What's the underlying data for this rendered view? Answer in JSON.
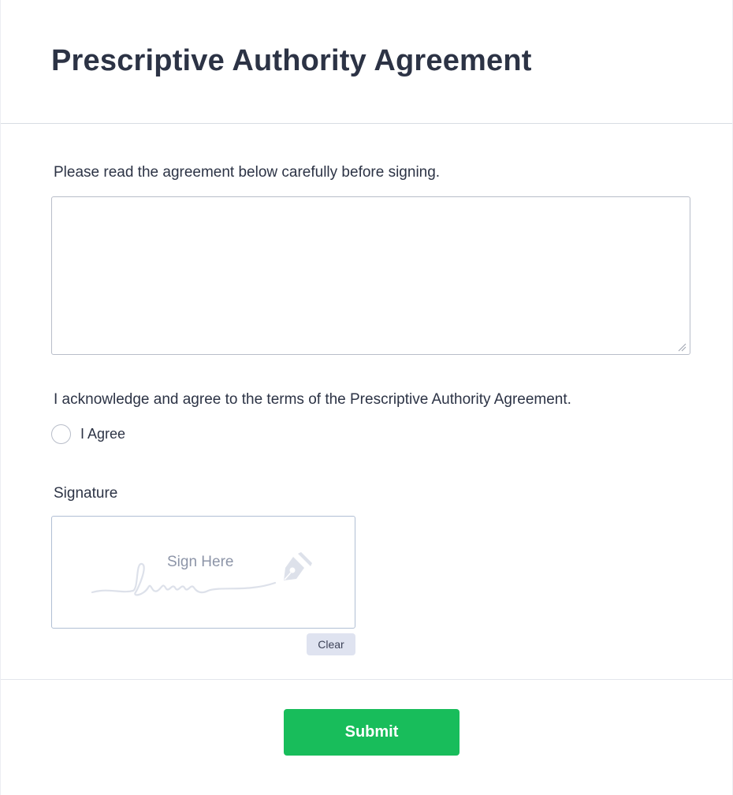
{
  "header": {
    "title": "Prescriptive Authority Agreement"
  },
  "agreement": {
    "instruction": "Please read the agreement below carefully before signing.",
    "text_value": ""
  },
  "acknowledgement": {
    "label": "I acknowledge and agree to the terms of the Prescriptive Authority Agreement.",
    "option_label": "I Agree",
    "selected": false
  },
  "signature": {
    "label": "Signature",
    "hint": "Sign Here",
    "clear_label": "Clear"
  },
  "footer": {
    "submit_label": "Submit"
  },
  "colors": {
    "title_text": "#2c3345",
    "submit_bg": "#18bd5b",
    "clear_bg": "#dfe3f0",
    "border": "#b8bdc9"
  }
}
